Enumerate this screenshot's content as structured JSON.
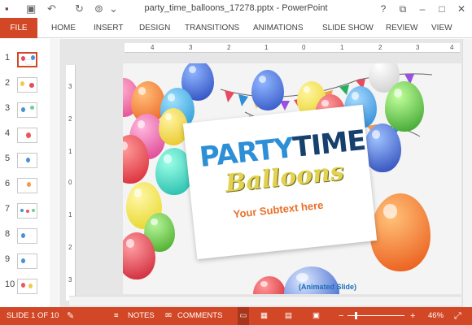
{
  "window": {
    "title": "party_time_balloons_17278.pptx - PowerPoint",
    "help_icon": "?",
    "minimize_icon": "–",
    "maximize_icon": "□",
    "close_icon": "✕"
  },
  "quick_access": {
    "save_icon": "▣",
    "undo_icon": "↶",
    "redo_icon": "↻",
    "customize_icon": "⌄"
  },
  "ribbon": {
    "file": "FILE",
    "tabs": [
      "HOME",
      "INSERT",
      "DESIGN",
      "TRANSITIONS",
      "ANIMATIONS",
      "SLIDE SHOW",
      "REVIEW",
      "VIEW"
    ]
  },
  "thumbnails": {
    "numbers": [
      "1",
      "2",
      "3",
      "4",
      "5",
      "6",
      "7",
      "8",
      "9",
      "10"
    ],
    "active": 1
  },
  "ruler": {
    "horizontal": [
      "4",
      "3",
      "2",
      "1",
      "0",
      "1",
      "2",
      "3",
      "4"
    ],
    "vertical": [
      "3",
      "2",
      "1",
      "0",
      "1",
      "2",
      "3"
    ]
  },
  "slide": {
    "title_part1": "PARTY",
    "title_part2": "TIME",
    "title_script": "Balloons",
    "subtext": "Your Subtext here",
    "caption": "(Animated Slide)"
  },
  "status": {
    "slide_info": "SLIDE 1 OF 10",
    "notes": "NOTES",
    "comments": "COMMENTS",
    "zoom_minus": "−",
    "zoom_plus": "+",
    "zoom": "46%"
  },
  "colors": {
    "accent": "#d24726",
    "title_light": "#2d8fd5",
    "title_dark": "#16406e",
    "script": "#e3d24f",
    "subtext": "#e8712a"
  }
}
